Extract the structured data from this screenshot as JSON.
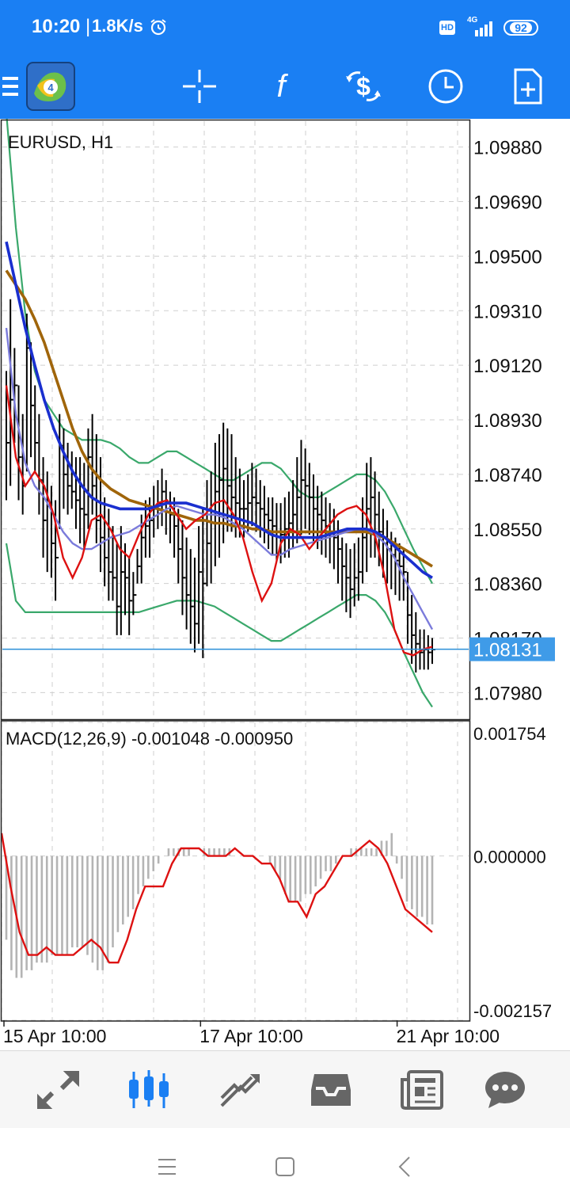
{
  "status_bar": {
    "time": "10:20",
    "net_speed": "1.8K/s",
    "hd_label": "HD",
    "network_label": "4G",
    "battery": "92"
  },
  "toolbar": {
    "icons": [
      "menu-icon",
      "app-logo",
      "crosshair-icon",
      "indicators-icon",
      "symbols-icon",
      "timeframe-icon",
      "new-order-icon"
    ]
  },
  "colors": {
    "accent": "#1a7ff3",
    "bar": "#000000",
    "bollinger": "#3aa86b",
    "ma_fast_red": "#dd1111",
    "ma_lavender": "#7b7bdb",
    "ma_blue": "#1a2fcf",
    "ma_brown": "#a0650a",
    "macd_hist": "#b4b4b4",
    "macd_signal": "#dd1111",
    "price_line": "#2a8fd8"
  },
  "chart_data": [
    {
      "type": "line",
      "title": "EURUSD, H1",
      "symbol": "EURUSD",
      "timeframe": "H1",
      "ylim": [
        1.0789,
        1.0997
      ],
      "y_ticks": [
        "1.09880",
        "1.09690",
        "1.09500",
        "1.09310",
        "1.09120",
        "1.08930",
        "1.08740",
        "1.08550",
        "1.08360",
        "1.08170",
        "1.07980"
      ],
      "y_tick_values": [
        1.0988,
        1.0969,
        1.095,
        1.0931,
        1.0912,
        1.0893,
        1.0874,
        1.0855,
        1.0836,
        1.0817,
        1.0798
      ],
      "current_price": "1.08131",
      "current_price_value": 1.08131,
      "x_tick_labels": [
        "15 Apr 10:00",
        "17 Apr 10:00",
        "21 Apr 10:00"
      ],
      "x_tick_index": [
        0,
        48,
        96
      ],
      "grid": true,
      "bars": [
        [
          1.091,
          1.0865,
          1.0885
        ],
        [
          1.0935,
          1.087,
          1.09
        ],
        [
          1.0918,
          1.0885,
          1.0905
        ],
        [
          1.0905,
          1.0865,
          1.088
        ],
        [
          1.0895,
          1.086,
          1.087
        ],
        [
          1.093,
          1.0875,
          1.0918
        ],
        [
          1.092,
          1.088,
          1.0898
        ],
        [
          1.0905,
          1.0875,
          1.0885
        ],
        [
          1.0895,
          1.086,
          1.0872
        ],
        [
          1.088,
          1.0845,
          1.0858
        ],
        [
          1.0875,
          1.084,
          1.0863
        ],
        [
          1.087,
          1.0838,
          1.085
        ],
        [
          1.0865,
          1.083,
          1.0845
        ],
        [
          1.0895,
          1.0855,
          1.0884
        ],
        [
          1.089,
          1.0862,
          1.0874
        ],
        [
          1.0885,
          1.086,
          1.087
        ],
        [
          1.0882,
          1.0862,
          1.0868
        ],
        [
          1.088,
          1.0855,
          1.0865
        ],
        [
          1.088,
          1.085,
          1.0862
        ],
        [
          1.0878,
          1.0848,
          1.086
        ],
        [
          1.089,
          1.0855,
          1.088
        ],
        [
          1.0895,
          1.086,
          1.087
        ],
        [
          1.0888,
          1.085,
          1.0858
        ],
        [
          1.088,
          1.084,
          1.0852
        ],
        [
          1.0866,
          1.0835,
          1.0845
        ],
        [
          1.0862,
          1.083,
          1.084
        ],
        [
          1.0856,
          1.083,
          1.0838
        ],
        [
          1.085,
          1.0818,
          1.0828
        ],
        [
          1.0856,
          1.0818,
          1.084
        ],
        [
          1.085,
          1.0825,
          1.0838
        ],
        [
          1.0845,
          1.0818,
          1.083
        ],
        [
          1.084,
          1.0825,
          1.0832
        ],
        [
          1.0848,
          1.0836,
          1.0842
        ],
        [
          1.086,
          1.0836,
          1.0852
        ],
        [
          1.0865,
          1.0845,
          1.0856
        ],
        [
          1.0866,
          1.0845,
          1.0858
        ],
        [
          1.087,
          1.0852,
          1.0862
        ],
        [
          1.0872,
          1.0855,
          1.0864
        ],
        [
          1.0876,
          1.0856,
          1.0868
        ],
        [
          1.0872,
          1.0853,
          1.0864
        ],
        [
          1.0868,
          1.085,
          1.086
        ],
        [
          1.0866,
          1.0845,
          1.0856
        ],
        [
          1.0862,
          1.0836,
          1.0848
        ],
        [
          1.0858,
          1.0825,
          1.0838
        ],
        [
          1.0852,
          1.082,
          1.0832
        ],
        [
          1.0848,
          1.0815,
          1.0828
        ],
        [
          1.0845,
          1.0812,
          1.0822
        ],
        [
          1.0856,
          1.0815,
          1.084
        ],
        [
          1.0862,
          1.081,
          1.0836
        ],
        [
          1.0872,
          1.0835,
          1.085
        ],
        [
          1.0875,
          1.0836,
          1.086
        ],
        [
          1.0885,
          1.0842,
          1.0868
        ],
        [
          1.0888,
          1.0845,
          1.0872
        ],
        [
          1.0892,
          1.085,
          1.0876
        ],
        [
          1.089,
          1.0854,
          1.087
        ],
        [
          1.0888,
          1.0854,
          1.0866
        ],
        [
          1.088,
          1.0852,
          1.0864
        ],
        [
          1.0876,
          1.0852,
          1.0862
        ],
        [
          1.0872,
          1.0852,
          1.0862
        ],
        [
          1.0874,
          1.0854,
          1.0864
        ],
        [
          1.0878,
          1.0856,
          1.0866
        ],
        [
          1.0876,
          1.0854,
          1.0864
        ],
        [
          1.0872,
          1.0852,
          1.0862
        ],
        [
          1.087,
          1.085,
          1.086
        ],
        [
          1.0866,
          1.0848,
          1.0858
        ],
        [
          1.0866,
          1.0846,
          1.0856
        ],
        [
          1.0864,
          1.0844,
          1.0854
        ],
        [
          1.0864,
          1.0843,
          1.0853
        ],
        [
          1.0866,
          1.0845,
          1.0855
        ],
        [
          1.0868,
          1.0845,
          1.0857
        ],
        [
          1.0872,
          1.0848,
          1.086
        ],
        [
          1.088,
          1.085,
          1.0866
        ],
        [
          1.0886,
          1.0853,
          1.0872
        ],
        [
          1.0883,
          1.0855,
          1.087
        ],
        [
          1.0878,
          1.0853,
          1.0866
        ],
        [
          1.0874,
          1.085,
          1.0862
        ],
        [
          1.087,
          1.0848,
          1.086
        ],
        [
          1.0868,
          1.0846,
          1.0858
        ],
        [
          1.0866,
          1.0845,
          1.0856
        ],
        [
          1.0864,
          1.0843,
          1.0854
        ],
        [
          1.0862,
          1.0841,
          1.0852
        ],
        [
          1.0858,
          1.0836,
          1.0848
        ],
        [
          1.0852,
          1.083,
          1.0842
        ],
        [
          1.085,
          1.0826,
          1.0838
        ],
        [
          1.0848,
          1.0824,
          1.0834
        ],
        [
          1.085,
          1.0828,
          1.0838
        ],
        [
          1.0852,
          1.083,
          1.084
        ],
        [
          1.0866,
          1.0836,
          1.0852
        ],
        [
          1.0878,
          1.084,
          1.0862
        ],
        [
          1.088,
          1.0845,
          1.0866
        ],
        [
          1.0875,
          1.0845,
          1.086
        ],
        [
          1.0868,
          1.0842,
          1.0854
        ],
        [
          1.0862,
          1.0838,
          1.085
        ],
        [
          1.0858,
          1.0836,
          1.0848
        ],
        [
          1.0854,
          1.0834,
          1.0846
        ],
        [
          1.0852,
          1.0832,
          1.0844
        ],
        [
          1.085,
          1.083,
          1.0842
        ],
        [
          1.0848,
          1.083,
          1.084
        ],
        [
          1.084,
          1.0815,
          1.0825
        ],
        [
          1.0832,
          1.0808,
          1.0818
        ],
        [
          1.0826,
          1.0805,
          1.0815
        ],
        [
          1.082,
          1.0806,
          1.0812
        ],
        [
          1.082,
          1.0806,
          1.0813
        ],
        [
          1.0818,
          1.0806,
          1.0812
        ],
        [
          1.0817,
          1.0808,
          1.0813
        ]
      ],
      "series": [
        {
          "values": [
            1.0905,
            1.088,
            1.087,
            1.0875,
            1.087,
            1.086,
            1.0845,
            1.0838,
            1.0845,
            1.0858,
            1.086,
            1.0855,
            1.0848,
            1.0845,
            1.0853,
            1.086,
            1.0864,
            1.0865,
            1.086,
            1.0855,
            1.0858,
            1.086,
            1.0864,
            1.0865,
            1.086,
            1.0852,
            1.084,
            1.083,
            1.0836,
            1.085,
            1.0855,
            1.0853,
            1.0848,
            1.0852,
            1.0856,
            1.086,
            1.0862,
            1.0863,
            1.086,
            1.0852,
            1.0838,
            1.082,
            1.0812,
            1.0811,
            1.0813,
            1.0814
          ]
        },
        {
          "values": [
            1.0925,
            1.0895,
            1.0878,
            1.087,
            1.0866,
            1.086,
            1.0854,
            1.085,
            1.0848,
            1.0848,
            1.085,
            1.0852,
            1.0853,
            1.0854,
            1.0856,
            1.0858,
            1.086,
            1.0862,
            1.0863,
            1.0862,
            1.0861,
            1.086,
            1.086,
            1.0859,
            1.0857,
            1.0855,
            1.0852,
            1.0849,
            1.0846,
            1.0846,
            1.0848,
            1.0849,
            1.085,
            1.0851,
            1.0852,
            1.0853,
            1.0854,
            1.0855,
            1.0855,
            1.0853,
            1.085,
            1.0845,
            1.0838,
            1.0832,
            1.0826,
            1.082
          ]
        },
        {
          "values": [
            1.0955,
            1.094,
            1.0925,
            1.0912,
            1.09,
            1.089,
            1.0882,
            1.0875,
            1.087,
            1.0866,
            1.0864,
            1.0863,
            1.0862,
            1.0862,
            1.0862,
            1.0862,
            1.0863,
            1.0864,
            1.0864,
            1.0864,
            1.0863,
            1.0862,
            1.0861,
            1.086,
            1.0859,
            1.0858,
            1.0857,
            1.0855,
            1.0853,
            1.0852,
            1.0852,
            1.0852,
            1.0852,
            1.0852,
            1.0853,
            1.0854,
            1.0855,
            1.0855,
            1.0855,
            1.0854,
            1.0852,
            1.0849,
            1.0846,
            1.0843,
            1.084,
            1.0838
          ]
        },
        {
          "values": [
            1.0945,
            1.094,
            1.0935,
            1.0928,
            1.092,
            1.091,
            1.09,
            1.089,
            1.0882,
            1.0876,
            1.0872,
            1.0869,
            1.0867,
            1.0865,
            1.0864,
            1.0863,
            1.0862,
            1.0861,
            1.086,
            1.0859,
            1.0858,
            1.0858,
            1.0857,
            1.0857,
            1.0856,
            1.0856,
            1.0855,
            1.0855,
            1.0854,
            1.0854,
            1.0854,
            1.0854,
            1.0854,
            1.0854,
            1.0854,
            1.0854,
            1.0854,
            1.0854,
            1.0854,
            1.0853,
            1.0852,
            1.085,
            1.0848,
            1.0846,
            1.0844,
            1.0842
          ]
        },
        {
          "values": [
            1.1,
            1.096,
            1.093,
            1.091,
            1.09,
            1.0895,
            1.089,
            1.0888,
            1.0886,
            1.0886,
            1.0886,
            1.0885,
            1.0883,
            1.088,
            1.0878,
            1.0878,
            1.088,
            1.0882,
            1.0882,
            1.088,
            1.0878,
            1.0876,
            1.0874,
            1.0872,
            1.0872,
            1.0874,
            1.0876,
            1.0878,
            1.0878,
            1.0876,
            1.0872,
            1.0868,
            1.0866,
            1.0866,
            1.0868,
            1.087,
            1.0872,
            1.0874,
            1.0874,
            1.0872,
            1.0868,
            1.0862,
            1.0855,
            1.0848,
            1.0842,
            1.0836
          ]
        },
        {
          "values": [
            1.085,
            1.083,
            1.0826,
            1.0826,
            1.0826,
            1.0826,
            1.0826,
            1.0826,
            1.0826,
            1.0826,
            1.0826,
            1.0826,
            1.0826,
            1.0826,
            1.0826,
            1.0827,
            1.0828,
            1.0829,
            1.083,
            1.083,
            1.083,
            1.0829,
            1.0828,
            1.0826,
            1.0824,
            1.0822,
            1.082,
            1.0818,
            1.0816,
            1.0816,
            1.0818,
            1.082,
            1.0822,
            1.0824,
            1.0826,
            1.0828,
            1.083,
            1.0832,
            1.0832,
            1.083,
            1.0826,
            1.082,
            1.0812,
            1.0805,
            1.0798,
            1.0793
          ]
        }
      ]
    },
    {
      "type": "bar",
      "title": "MACD(12,26,9) -0.001048 -0.000950",
      "indicator": "MACD(12,26,9)",
      "main_value": "-0.001048",
      "signal_value": "-0.000950",
      "ylim": [
        -0.002157,
        0.001754
      ],
      "y_ticks": [
        "0.001754",
        "0.000000",
        "-0.002157"
      ],
      "y_tick_values": [
        0.001754,
        0.0,
        -0.002157
      ],
      "grid": true,
      "histogram": [
        -0.0011,
        -0.0015,
        -0.0016,
        -0.0016,
        -0.0015,
        -0.0015,
        -0.0014,
        -0.0014,
        -0.0014,
        -0.0013,
        -0.0013,
        -0.0013,
        -0.0013,
        -0.0012,
        -0.0012,
        -0.0012,
        -0.0013,
        -0.0014,
        -0.0015,
        -0.0015,
        -0.0014,
        -0.0012,
        -0.001,
        -0.0009,
        -0.0008,
        -0.0007,
        -0.0005,
        -0.0004,
        -0.0003,
        -0.0002,
        -0.0001,
        0.0,
        0.0001,
        0.0001,
        0.0001,
        0.0001,
        0.0001,
        0.0,
        0.0,
        0.0001,
        0.0001,
        0.0001,
        0.0001,
        0.0001,
        0.0001,
        0.0,
        0.0,
        0.0,
        0.0,
        0.0,
        0.0,
        0.0,
        -0.0001,
        -0.0002,
        -0.0003,
        -0.0005,
        -0.0006,
        -0.0006,
        -0.0006,
        -0.0005,
        -0.0005,
        -0.0004,
        -0.0003,
        -0.0002,
        -0.0002,
        -0.0001,
        0.0,
        0.0,
        0.0001,
        0.0001,
        0.0001,
        0.0001,
        0.0001,
        0.0001,
        0.0002,
        0.0002,
        0.0003,
        -0.0001,
        -0.0003,
        -0.0006,
        -0.0007,
        -0.0008,
        -0.0008,
        -0.0009,
        -0.0009
      ],
      "signal": [
        0.0003,
        -0.0004,
        -0.001,
        -0.0013,
        -0.0013,
        -0.0012,
        -0.0013,
        -0.0013,
        -0.0013,
        -0.0012,
        -0.0011,
        -0.0012,
        -0.0014,
        -0.0014,
        -0.0011,
        -0.0007,
        -0.0004,
        -0.0004,
        -0.0004,
        -0.0001,
        0.0001,
        0.0001,
        0.0001,
        0.0,
        0.0,
        0.0,
        0.0001,
        0.0,
        0.0,
        -0.0001,
        -0.0001,
        -0.0003,
        -0.0006,
        -0.0006,
        -0.0008,
        -0.0005,
        -0.0004,
        -0.0002,
        0.0,
        0.0,
        0.0001,
        0.0002,
        0.0001,
        -0.0001,
        -0.0004,
        -0.0007,
        -0.0008,
        -0.0009,
        -0.001
      ]
    }
  ],
  "bottom_nav": {
    "items": [
      {
        "name": "quotes",
        "icon": "quotes-icon"
      },
      {
        "name": "chart",
        "icon": "chart-icon",
        "active": true
      },
      {
        "name": "trade",
        "icon": "trade-icon"
      },
      {
        "name": "history",
        "icon": "history-icon"
      },
      {
        "name": "news",
        "icon": "news-icon"
      },
      {
        "name": "messages",
        "icon": "messages-icon"
      }
    ]
  },
  "system_nav": [
    "recents-icon",
    "home-icon",
    "back-icon"
  ]
}
